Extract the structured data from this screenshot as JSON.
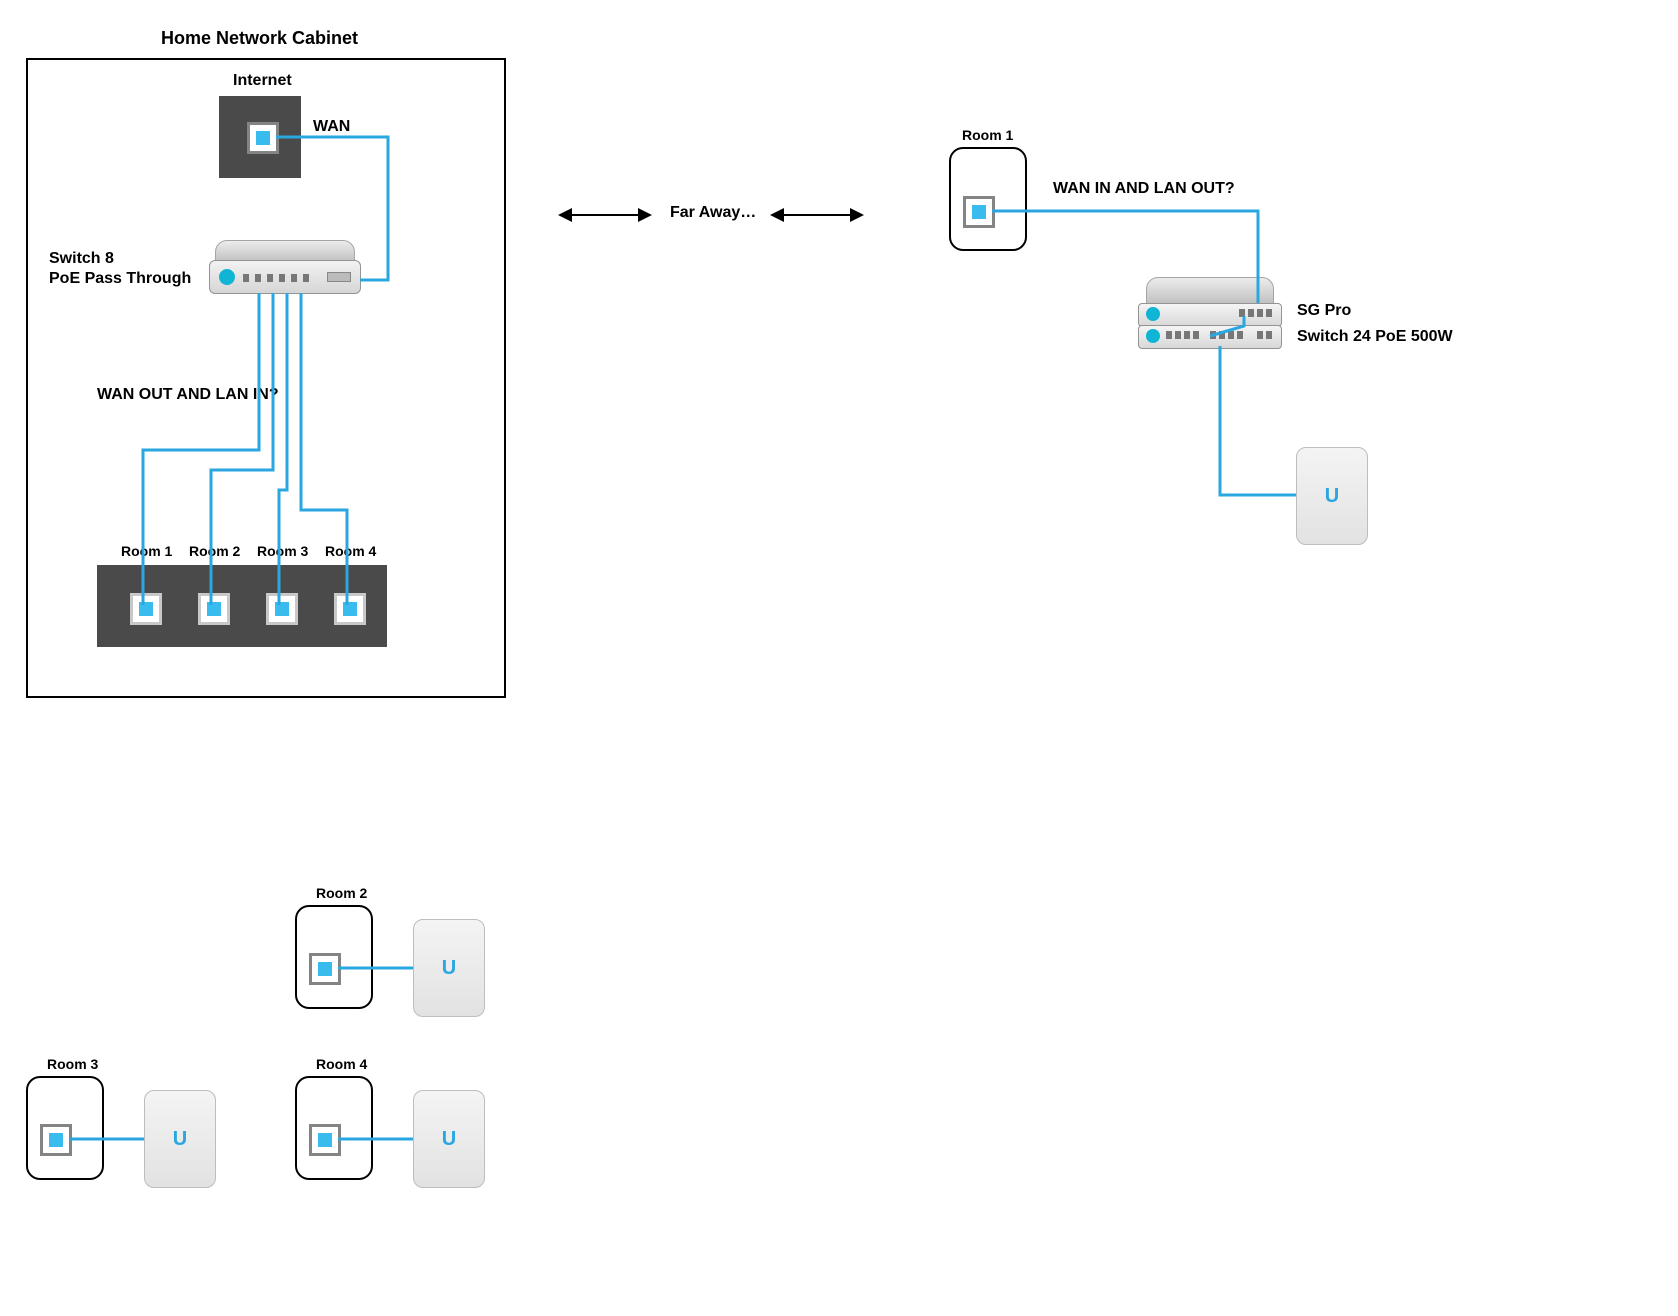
{
  "title": "Home Network Cabinet",
  "cabinet": {
    "internet_label": "Internet",
    "wan_label": "WAN",
    "switch8_label_line1": "Switch 8",
    "switch8_label_line2": "PoE Pass Through",
    "question": "WAN OUT AND LAN IN?",
    "patch_rooms": [
      "Room 1",
      "Room 2",
      "Room 3",
      "Room 4"
    ]
  },
  "center": {
    "far_away": "Far Away…"
  },
  "room1": {
    "label": "Room 1",
    "question": "WAN  IN AND LAN OUT?",
    "sg_label": "SG Pro",
    "switch24_label": "Switch 24 PoE 500W"
  },
  "rooms_bottom": {
    "r2": "Room 2",
    "r3": "Room 3",
    "r4": "Room 4"
  },
  "ap_logo": "U",
  "colors": {
    "cable": "#2aa7e0",
    "panel": "#4a4a4a"
  },
  "chart_data": {
    "type": "diagram",
    "nodes": [
      {
        "id": "internet",
        "type": "isp-jack",
        "in": "cabinet"
      },
      {
        "id": "switch8",
        "type": "switch",
        "label": "Switch 8 PoE Pass Through",
        "in": "cabinet"
      },
      {
        "id": "patch",
        "type": "patch-panel",
        "ports": [
          "Room 1",
          "Room 2",
          "Room 3",
          "Room 4"
        ],
        "in": "cabinet"
      },
      {
        "id": "room1-wall",
        "type": "wall-jack",
        "label": "Room 1"
      },
      {
        "id": "sgpro",
        "type": "gateway",
        "label": "SG Pro"
      },
      {
        "id": "switch24",
        "type": "switch",
        "label": "Switch 24 PoE 500W"
      },
      {
        "id": "ap-room1",
        "type": "access-point"
      },
      {
        "id": "room2-wall",
        "type": "wall-jack",
        "label": "Room 2"
      },
      {
        "id": "ap-room2",
        "type": "access-point"
      },
      {
        "id": "room3-wall",
        "type": "wall-jack",
        "label": "Room 3"
      },
      {
        "id": "ap-room3",
        "type": "access-point"
      },
      {
        "id": "room4-wall",
        "type": "wall-jack",
        "label": "Room 4"
      },
      {
        "id": "ap-room4",
        "type": "access-point"
      }
    ],
    "edges": [
      {
        "from": "internet",
        "to": "switch8",
        "label": "WAN"
      },
      {
        "from": "switch8",
        "to": "patch.Room 1"
      },
      {
        "from": "switch8",
        "to": "patch.Room 2"
      },
      {
        "from": "switch8",
        "to": "patch.Room 3"
      },
      {
        "from": "switch8",
        "to": "patch.Room 4"
      },
      {
        "from": "patch.Room 1",
        "to": "room1-wall",
        "note": "Far Away…"
      },
      {
        "from": "room1-wall",
        "to": "sgpro",
        "label": "WAN IN AND LAN OUT?"
      },
      {
        "from": "sgpro",
        "to": "switch24"
      },
      {
        "from": "switch24",
        "to": "ap-room1"
      },
      {
        "from": "room2-wall",
        "to": "ap-room2"
      },
      {
        "from": "room3-wall",
        "to": "ap-room3"
      },
      {
        "from": "room4-wall",
        "to": "ap-room4"
      }
    ],
    "open_questions": [
      "WAN OUT AND LAN IN?",
      "WAN  IN AND LAN OUT?"
    ]
  }
}
